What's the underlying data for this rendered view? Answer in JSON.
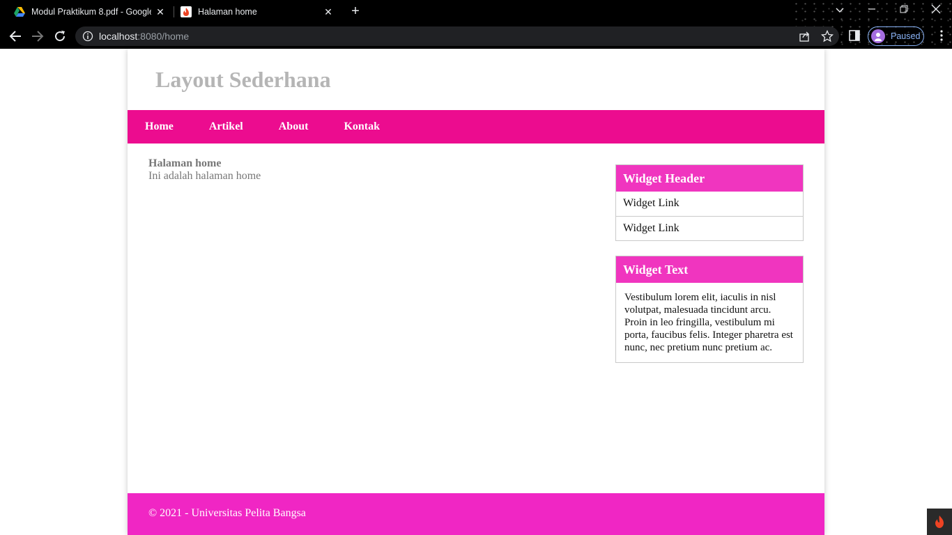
{
  "browser": {
    "tabs": [
      {
        "title": "Modul Praktikum 8.pdf - Google",
        "favicon": "google-drive-icon",
        "active": false
      },
      {
        "title": "Halaman home",
        "favicon": "codeigniter-flame-icon",
        "active": true
      }
    ],
    "url_host": "localhost",
    "url_path": ":8080/home",
    "profile_label": "Paused"
  },
  "site": {
    "title": "Layout Sederhana",
    "nav": [
      "Home",
      "Artikel",
      "About",
      "Kontak"
    ],
    "content": {
      "heading": "Halaman home",
      "text": "Ini adalah halaman home"
    },
    "widget_header": {
      "title": "Widget Header",
      "links": [
        "Widget Link",
        "Widget Link"
      ]
    },
    "widget_text": {
      "title": "Widget Text",
      "body": "Vestibulum lorem elit, iaculis in nisl volutpat, malesuada tincidunt arcu. Proin in leo fringilla, vestibulum mi porta, faucibus felis. Integer pharetra est nunc, nec pretium nunc pretium ac."
    },
    "footer": "© 2021 - Universitas Pelita Bangsa"
  },
  "colors": {
    "nav_bg": "#ec0c8f",
    "widget_head_bg": "#f035bf",
    "footer_bg": "#f026c4",
    "title_color": "#b5b5b5"
  }
}
